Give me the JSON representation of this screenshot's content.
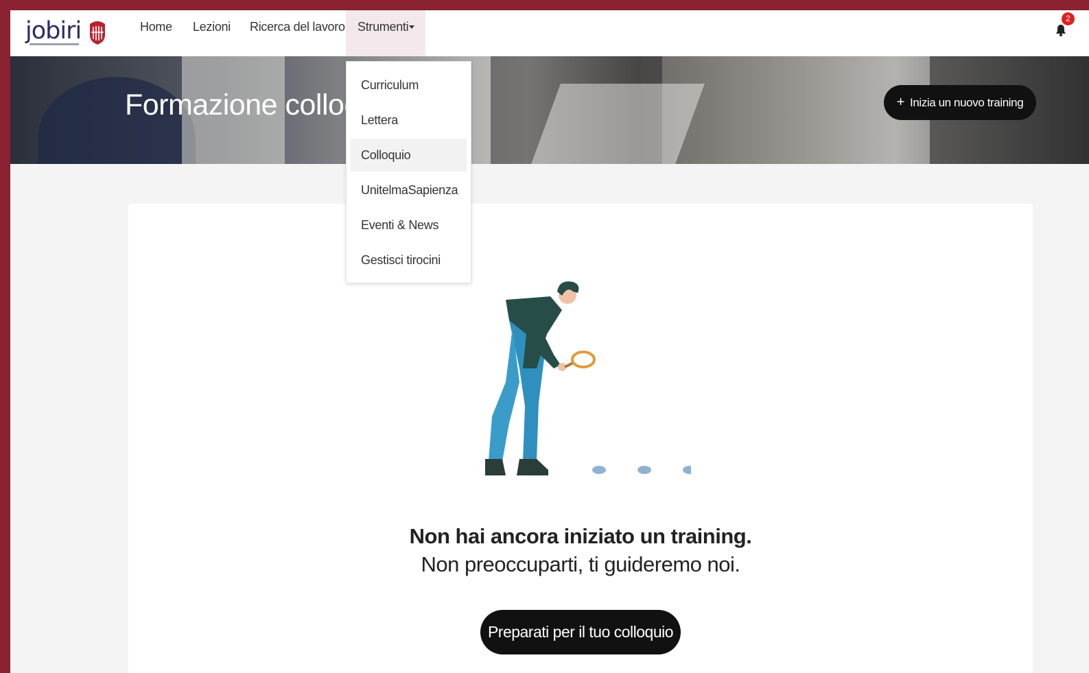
{
  "brand": {
    "logo_text": "jobiri"
  },
  "nav": {
    "items": [
      {
        "label": "Home"
      },
      {
        "label": "Lezioni"
      },
      {
        "label": "Ricerca del lavoro"
      }
    ],
    "dropdown_label": "Strumenti",
    "notifications_count": "2"
  },
  "dropdown": {
    "items": [
      {
        "label": "Curriculum"
      },
      {
        "label": "Lettera"
      },
      {
        "label": "Colloquio",
        "active": true
      },
      {
        "label": "UnitelmaSapienza"
      },
      {
        "label": "Eventi & News"
      },
      {
        "label": "Gestisci tirocini"
      }
    ]
  },
  "hero": {
    "title": "Formazione colloq",
    "new_training_label": "Inizia un nuovo training"
  },
  "empty_state": {
    "line1": "Non hai ancora iniziato un training.",
    "line2": "Non preoccuparti, ti guideremo noi.",
    "cta_label": "Preparati per il tuo colloquio"
  },
  "colors": {
    "frame": "#8a2232",
    "button": "#111111",
    "badge": "#e02020",
    "illustration_shirt": "#274d48",
    "illustration_pants": "#2f8fbe",
    "illustration_lens": "#e29a3a"
  }
}
